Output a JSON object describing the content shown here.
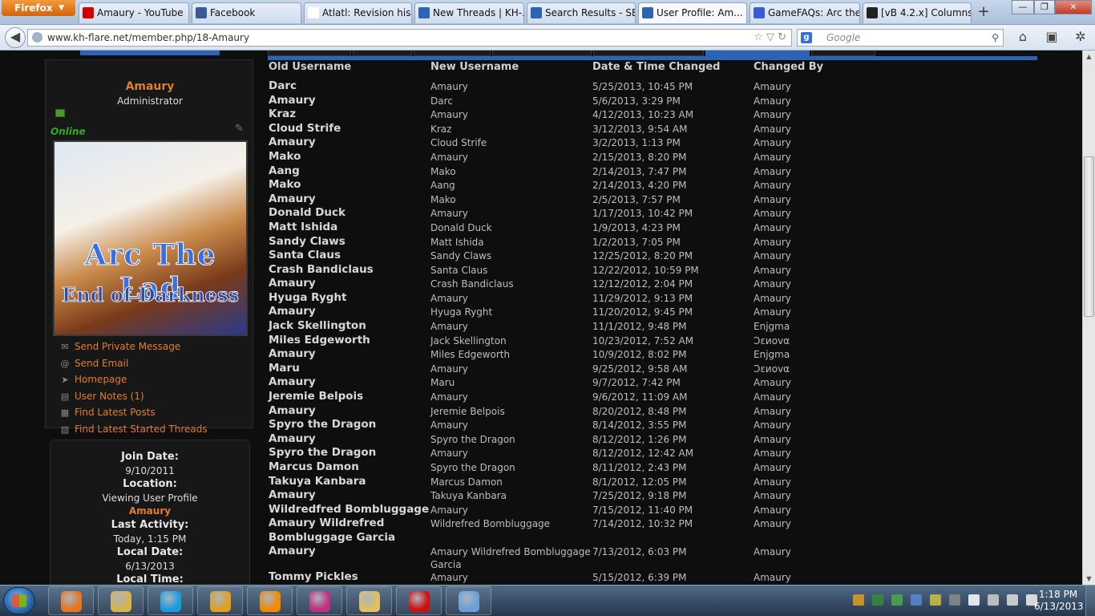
{
  "browser": {
    "menu_label": "Firefox",
    "tabs": [
      {
        "title": "Amaury - YouTube",
        "icon": "youtube-icon",
        "color": "#d40000"
      },
      {
        "title": "Facebook",
        "icon": "facebook-icon",
        "color": "#3b5998"
      },
      {
        "title": "Atlatl: Revision hist...",
        "icon": "wikipedia-icon",
        "color": "#ffffff"
      },
      {
        "title": "New Threads | KH-...",
        "icon": "forum-icon",
        "color": "#2b64b6"
      },
      {
        "title": "Search Results - SE...",
        "icon": "forum-icon",
        "color": "#2b64b6"
      },
      {
        "title": "User Profile: Am...",
        "icon": "forum-icon",
        "color": "#2b64b6",
        "active": true
      },
      {
        "title": "GameFAQs: Arc the...",
        "icon": "gamefaqs-icon",
        "color": "#3a5bd8"
      },
      {
        "title": "[vB 4.2.x] Columns'...",
        "icon": "vbulletin-icon",
        "color": "#222222"
      }
    ],
    "new_tab_label": "+",
    "url": "www.kh-flare.net/member.php/18-Amaury",
    "search_placeholder": "Google",
    "window_buttons": {
      "minimize": "—",
      "maximize": "❐",
      "close": "✕"
    }
  },
  "profile": {
    "username": "Amaury",
    "usertitle": "Administrator",
    "status": "Online",
    "avatar": {
      "line1": "Arc The Lad",
      "line2": "End of Darkness"
    },
    "links": [
      {
        "label": "Send Private Message",
        "icon": "envelope-icon"
      },
      {
        "label": "Send Email",
        "icon": "at-icon"
      },
      {
        "label": "Homepage",
        "icon": "cursor-icon"
      },
      {
        "label": "User Notes (1)",
        "icon": "notes-icon"
      },
      {
        "label": "Find Latest Posts",
        "icon": "posts-icon"
      },
      {
        "label": "Find Latest Started Threads",
        "icon": "threads-icon"
      }
    ],
    "info": [
      {
        "label": "Join Date:",
        "value": "9/10/2011"
      },
      {
        "label": "Location:",
        "value": "Viewing User Profile",
        "value2": "Amaury"
      },
      {
        "label": "Last Activity:",
        "value": "Today, 1:15 PM"
      },
      {
        "label": "Local Date:",
        "value": "6/13/2013"
      },
      {
        "label": "Local Time:",
        "value": ""
      }
    ]
  },
  "history": {
    "headers": {
      "old": "Old Username",
      "new": "New Username",
      "date": "Date & Time Changed",
      "by": "Changed By"
    },
    "rows": [
      {
        "old": "Darc",
        "new": "Amaury",
        "date": "5/25/2013, 10:45 PM",
        "by": "Amaury"
      },
      {
        "old": "Amaury",
        "new": "Darc",
        "date": "5/6/2013, 3:29 PM",
        "by": "Amaury"
      },
      {
        "old": "Kraz",
        "new": "Amaury",
        "date": "4/12/2013, 10:23 AM",
        "by": "Amaury"
      },
      {
        "old": "Cloud Strife",
        "new": "Kraz",
        "date": "3/12/2013, 9:54 AM",
        "by": "Amaury"
      },
      {
        "old": "Amaury",
        "new": "Cloud Strife",
        "date": "3/2/2013, 1:13 PM",
        "by": "Amaury"
      },
      {
        "old": "Mako",
        "new": "Amaury",
        "date": "2/15/2013, 8:20 PM",
        "by": "Amaury"
      },
      {
        "old": "Aang",
        "new": "Mako",
        "date": "2/14/2013, 7:47 PM",
        "by": "Amaury"
      },
      {
        "old": "Mako",
        "new": "Aang",
        "date": "2/14/2013, 4:20 PM",
        "by": "Amaury"
      },
      {
        "old": "Amaury",
        "new": "Mako",
        "date": "2/5/2013, 7:57 PM",
        "by": "Amaury"
      },
      {
        "old": "Donald Duck",
        "new": "Amaury",
        "date": "1/17/2013, 10:42 PM",
        "by": "Amaury"
      },
      {
        "old": "Matt Ishida",
        "new": "Donald Duck",
        "date": "1/9/2013, 4:23 PM",
        "by": "Amaury"
      },
      {
        "old": "Sandy Claws",
        "new": "Matt Ishida",
        "date": "1/2/2013, 7:05 PM",
        "by": "Amaury"
      },
      {
        "old": "Santa Claus",
        "new": "Sandy Claws",
        "date": "12/25/2012, 8:20 PM",
        "by": "Amaury"
      },
      {
        "old": "Crash Bandiclaus",
        "new": "Santa Claus",
        "date": "12/22/2012, 10:59 PM",
        "by": "Amaury"
      },
      {
        "old": "Amaury",
        "new": "Crash Bandiclaus",
        "date": "12/12/2012, 2:04 PM",
        "by": "Amaury"
      },
      {
        "old": "Hyuga Ryght",
        "new": "Amaury",
        "date": "11/29/2012, 9:13 PM",
        "by": "Amaury"
      },
      {
        "old": "Amaury",
        "new": "Hyuga Ryght",
        "date": "11/20/2012, 9:45 PM",
        "by": "Amaury"
      },
      {
        "old": "Jack Skellington",
        "new": "Amaury",
        "date": "11/1/2012, 9:48 PM",
        "by": "Enjgma"
      },
      {
        "old": "Miles Edgeworth",
        "new": "Jack Skellington",
        "date": "10/23/2012, 7:52 AM",
        "by": "Ɔɛиovα"
      },
      {
        "old": "Amaury",
        "new": "Miles Edgeworth",
        "date": "10/9/2012, 8:02 PM",
        "by": "Enjgma"
      },
      {
        "old": "Maru",
        "new": "Amaury",
        "date": "9/25/2012, 9:58 AM",
        "by": "Ɔɛиovα"
      },
      {
        "old": "Amaury",
        "new": "Maru",
        "date": "9/7/2012, 7:42 PM",
        "by": "Amaury"
      },
      {
        "old": "Jeremie Belpois",
        "new": "Amaury",
        "date": "9/6/2012, 11:09 AM",
        "by": "Amaury"
      },
      {
        "old": "Amaury",
        "new": "Jeremie Belpois",
        "date": "8/20/2012, 8:48 PM",
        "by": "Amaury"
      },
      {
        "old": "Spyro the Dragon",
        "new": "Amaury",
        "date": "8/14/2012, 3:55 PM",
        "by": "Amaury"
      },
      {
        "old": "Amaury",
        "new": "Spyro the Dragon",
        "date": "8/12/2012, 1:26 PM",
        "by": "Amaury"
      },
      {
        "old": "Spyro the Dragon",
        "new": "Amaury",
        "date": "8/12/2012, 12:42 AM",
        "by": "Amaury"
      },
      {
        "old": "Marcus Damon",
        "new": "Spyro the Dragon",
        "date": "8/11/2012, 2:43 PM",
        "by": "Amaury"
      },
      {
        "old": "Takuya Kanbara",
        "new": "Marcus Damon",
        "date": "8/1/2012, 12:05 PM",
        "by": "Amaury"
      },
      {
        "old": "Amaury",
        "new": "Takuya Kanbara",
        "date": "7/25/2012, 9:18 PM",
        "by": "Amaury"
      },
      {
        "old": "Wildredfred Bombluggage",
        "new": "Amaury",
        "date": "7/15/2012, 11:40 PM",
        "by": "Amaury"
      },
      {
        "old": "Amaury Wildrefred",
        "new": "Wildrefred Bombluggage",
        "date": "7/14/2012, 10:32 PM",
        "by": "Amaury"
      },
      {
        "old": "Bombluggage Garcia",
        "new": "",
        "date": "",
        "by": ""
      },
      {
        "old": "Amaury",
        "new": "Amaury Wildrefred Bombluggage",
        "date": "7/13/2012, 6:03 PM",
        "by": "Amaury"
      },
      {
        "old": "",
        "new": "Garcia",
        "date": "",
        "by": ""
      },
      {
        "old": "Tommy Pickles",
        "new": "Amaury",
        "date": "5/15/2012, 6:39 PM",
        "by": "Amaury"
      }
    ]
  },
  "taskbar": {
    "apps": [
      {
        "name": "firefox-app",
        "color": "#e8761e"
      },
      {
        "name": "explorer-app",
        "color": "#d9b44a"
      },
      {
        "name": "skype-app",
        "color": "#1a9be0"
      },
      {
        "name": "media-app",
        "color": "#e0a020"
      },
      {
        "name": "vlc-app",
        "color": "#f08a00"
      },
      {
        "name": "paint-tools-app",
        "color": "#c03080"
      },
      {
        "name": "folder-app",
        "color": "#e0c060"
      },
      {
        "name": "record-app",
        "color": "#d01010"
      },
      {
        "name": "paint-app",
        "color": "#6aa0d8"
      }
    ],
    "time": "1:18 PM",
    "date": "6/13/2013"
  }
}
